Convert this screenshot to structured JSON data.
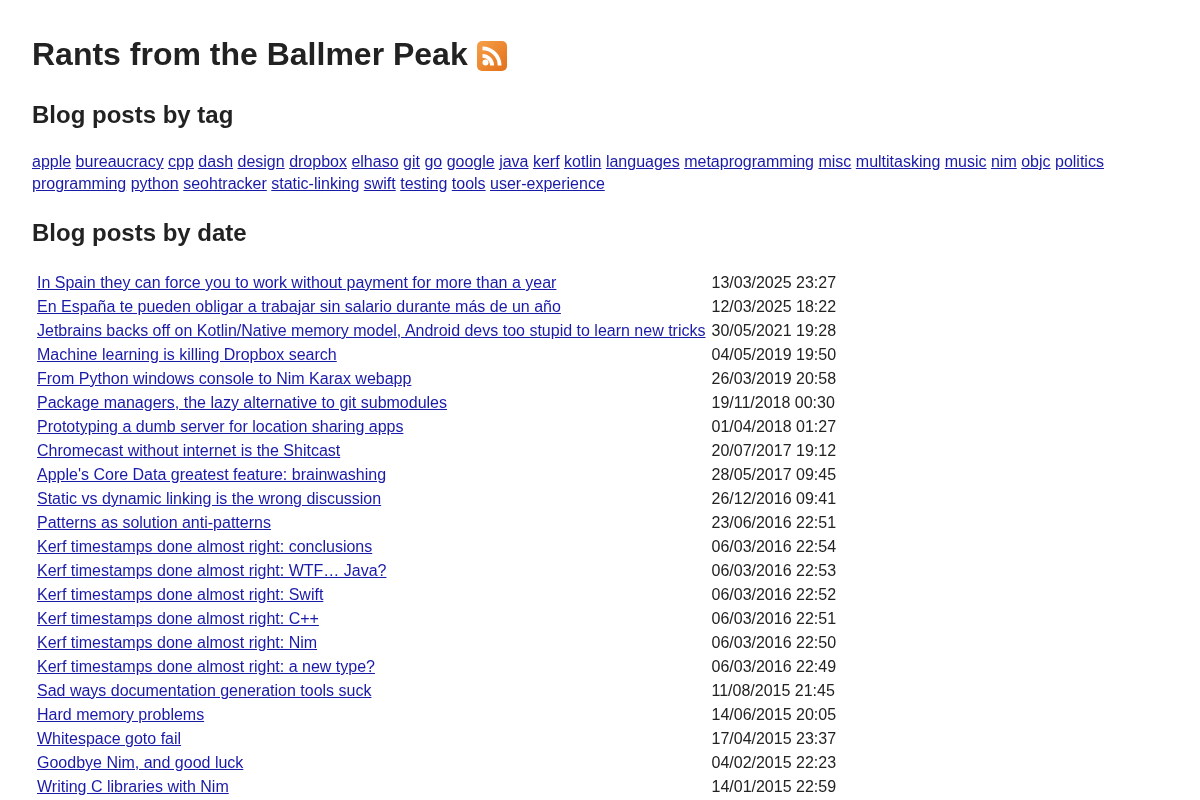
{
  "title": "Rants from the Ballmer Peak",
  "tags_section": {
    "heading": "Blog posts by tag",
    "tags": [
      "apple",
      "bureaucracy",
      "cpp",
      "dash",
      "design",
      "dropbox",
      "elhaso",
      "git",
      "go",
      "google",
      "java",
      "kerf",
      "kotlin",
      "languages",
      "metaprogramming",
      "misc",
      "multitasking",
      "music",
      "nim",
      "objc",
      "politics",
      "programming",
      "python",
      "seohtracker",
      "static-linking",
      "swift",
      "testing",
      "tools",
      "user-experience"
    ]
  },
  "date_section": {
    "heading": "Blog posts by date",
    "posts": [
      {
        "title": "In Spain they can force you to work without payment for more than a year",
        "date": "13/03/2025 23:27"
      },
      {
        "title": "En España te pueden obligar a trabajar sin salario durante más de un año",
        "date": "12/03/2025 18:22"
      },
      {
        "title": "Jetbrains backs off on Kotlin/Native memory model, Android devs too stupid to learn new tricks",
        "date": "30/05/2021 19:28"
      },
      {
        "title": "Machine learning is killing Dropbox search",
        "date": "04/05/2019 19:50"
      },
      {
        "title": "From Python windows console to Nim Karax webapp",
        "date": "26/03/2019 20:58"
      },
      {
        "title": "Package managers, the lazy alternative to git submodules",
        "date": "19/11/2018 00:30"
      },
      {
        "title": "Prototyping a dumb server for location sharing apps",
        "date": "01/04/2018 01:27"
      },
      {
        "title": "Chromecast without internet is the Shitcast",
        "date": "20/07/2017 19:12"
      },
      {
        "title": "Apple's Core Data greatest feature: brainwashing",
        "date": "28/05/2017 09:45"
      },
      {
        "title": "Static vs dynamic linking is the wrong discussion",
        "date": "26/12/2016 09:41"
      },
      {
        "title": "Patterns as solution anti-patterns",
        "date": "23/06/2016 22:51"
      },
      {
        "title": "Kerf timestamps done almost right: conclusions",
        "date": "06/03/2016 22:54"
      },
      {
        "title": "Kerf timestamps done almost right: WTF… Java?",
        "date": "06/03/2016 22:53"
      },
      {
        "title": "Kerf timestamps done almost right: Swift",
        "date": "06/03/2016 22:52"
      },
      {
        "title": "Kerf timestamps done almost right: C++",
        "date": "06/03/2016 22:51"
      },
      {
        "title": "Kerf timestamps done almost right: Nim",
        "date": "06/03/2016 22:50"
      },
      {
        "title": "Kerf timestamps done almost right: a new type?",
        "date": "06/03/2016 22:49"
      },
      {
        "title": "Sad ways documentation generation tools suck",
        "date": "11/08/2015 21:45"
      },
      {
        "title": "Hard memory problems",
        "date": "14/06/2015 20:05"
      },
      {
        "title": "Whitespace goto fail",
        "date": "17/04/2015 23:37"
      },
      {
        "title": "Goodbye Nim, and good luck",
        "date": "04/02/2015 22:23"
      },
      {
        "title": "Writing C libraries with Nim",
        "date": "14/01/2015 22:59"
      }
    ]
  }
}
